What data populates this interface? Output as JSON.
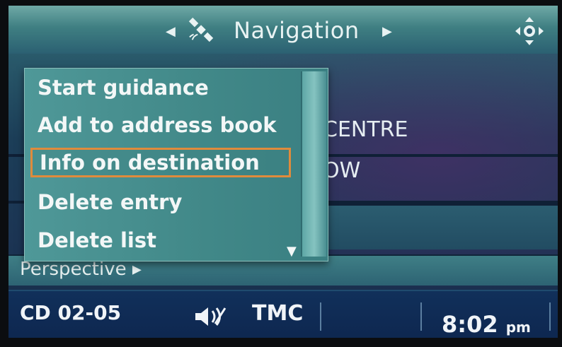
{
  "header": {
    "title": "Navigation",
    "prev_arrow": "◀",
    "next_arrow": "▶",
    "icon": "satellite-icon",
    "controller_icon": "nav-controller-icon"
  },
  "background_list": {
    "row1_partial": "CENTRE",
    "row2_partial": "OW",
    "perspective_label": "Perspective ▸"
  },
  "menu": {
    "items": [
      {
        "label": "Start guidance"
      },
      {
        "label": "Add to address book"
      },
      {
        "label": "Info on destination",
        "selected": true
      },
      {
        "label": "Delete entry"
      },
      {
        "label": "Delete list"
      }
    ],
    "scroll_arrow": "▼"
  },
  "status_bar": {
    "source": "CD 02-05",
    "speaker_icon": "speaker-icon",
    "tmc": "TMC",
    "time": "8:02",
    "ampm": "pm"
  },
  "colors": {
    "selection_outline": "#e08b3c",
    "menu_bg": "#4a9292",
    "status_bg": "#102d58"
  }
}
